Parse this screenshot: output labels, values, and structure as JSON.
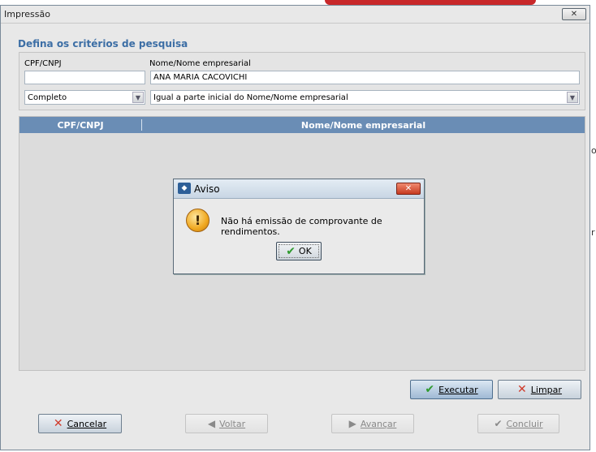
{
  "window": {
    "title": "Impressão"
  },
  "criteria": {
    "section_title": "Defina os critérios de pesquisa",
    "cpf_label": "CPF/CNPJ",
    "cpf_value": "",
    "name_label": "Nome/Nome empresarial",
    "name_value": "ANA MARIA CACOVICHI",
    "mode_select": "Completo",
    "match_select": "Igual a parte inicial do Nome/Nome empresarial"
  },
  "grid": {
    "columns": [
      "CPF/CNPJ",
      "Nome/Nome empresarial"
    ]
  },
  "buttons": {
    "executar": "Executar",
    "limpar": "Limpar",
    "cancelar": "Cancelar",
    "voltar": "Voltar",
    "avancar": "Avançar",
    "concluir": "Concluir"
  },
  "dialog": {
    "title": "Aviso",
    "message": "Não há emissão de comprovante de rendimentos.",
    "ok_label": "OK"
  },
  "icons": {
    "check": "check-icon",
    "x": "x-icon",
    "warning": "warning-icon",
    "left": "arrow-left-icon",
    "right": "arrow-right-icon"
  },
  "background": {
    "letter_1": "o",
    "letter_2": "r"
  }
}
